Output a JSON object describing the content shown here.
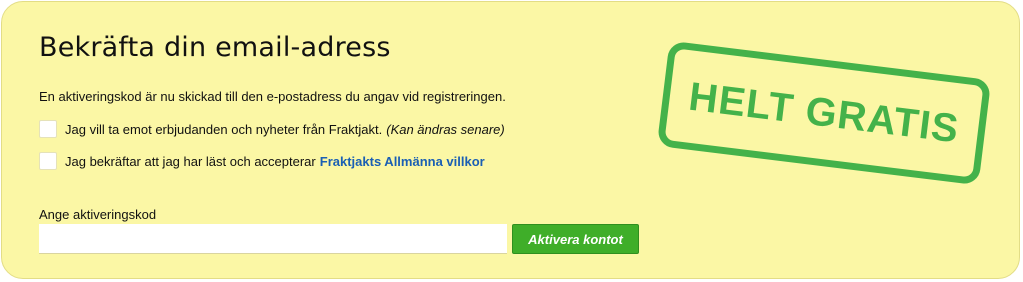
{
  "form": {
    "title": "Bekräfta din email-adress",
    "intro": "En aktiveringskod är nu skickad till den e-postadress du angav vid registreringen.",
    "offers_checkbox": {
      "label": "Jag vill ta emot erbjudanden och nyheter från Fraktjakt.",
      "note": "(Kan ändras senare)",
      "checked": false
    },
    "terms_checkbox": {
      "label": "Jag bekräftar att jag har läst och accepterar",
      "link_text": "Fraktjakts Allmänna villkor",
      "checked": false
    },
    "code_label": "Ange aktiveringskod",
    "code_value": "",
    "activate_label": "Aktivera kontot"
  },
  "stamp": {
    "text": "HELT GRATIS"
  },
  "colors": {
    "panel_background": "#fbf7a5",
    "button_green": "#3fae29",
    "stamp_green": "#44b24a",
    "link_blue": "#1a5fb4"
  }
}
